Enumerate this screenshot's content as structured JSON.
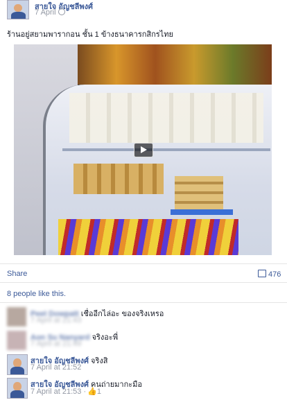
{
  "post": {
    "author": "สายใจ อัญชลีพงศ์",
    "date": "7 April",
    "text": "ร้านอยู่สยามพารากอน ชั้น 1 ข้างธนาคารกสิกรไทย"
  },
  "actions": {
    "share_label": "Share",
    "comment_count": "476"
  },
  "likes_text": "8 people like this.",
  "comments": [
    {
      "name": "Peet Dowpatt",
      "text": "เชื่ออีกไล่อะ ของจริงเหรอ",
      "time": "7 April at 21:43",
      "blurred": true
    },
    {
      "name": "Aon Su Nanyard",
      "text": "จริงอะพี่",
      "time": "7 April at 21:49",
      "blurred": true
    },
    {
      "name": "สายใจ อัญชลีพงศ์",
      "text": "จริงสิ",
      "time": "7 April at 21:52",
      "blurred": false
    },
    {
      "name": "สายใจ อัญชลีพงศ์",
      "text": "คนถ่ายมากะมือ",
      "time": "7 April at 21:53 ·",
      "likes": "1",
      "blurred": false
    }
  ]
}
